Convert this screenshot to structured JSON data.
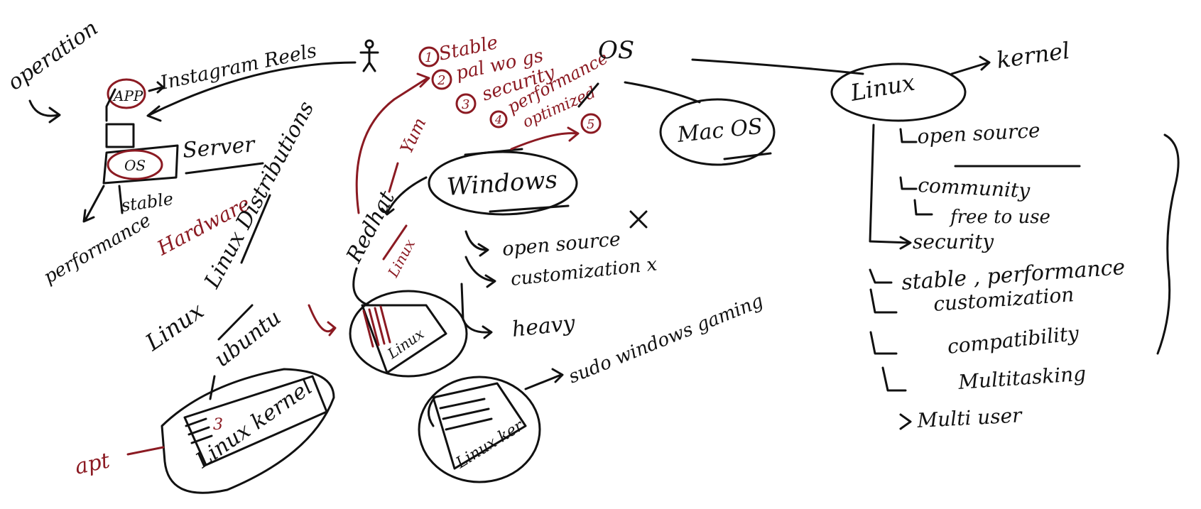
{
  "colors": {
    "ink": "#111111",
    "accent": "#8b1a22",
    "background": "#ffffff"
  },
  "notes": {
    "operation": "operation",
    "instagram_reels": "Instagram Reels",
    "app": "APP",
    "os_box": "OS",
    "server": "Server",
    "stable": "stable",
    "performance": "performance",
    "hardware": "Hardware",
    "os_main": "OS",
    "mac_os": "Mac OS",
    "linux_top": "Linux",
    "kernel": "kernel",
    "linux_distributions": "Linux Distributions",
    "ubuntu": "ubuntu",
    "apt": "apt",
    "linux_kernel": "Linux kernel",
    "redhat": "Redhat",
    "yum": "Yum",
    "linux_red": "Linux",
    "linux_small": "Linux",
    "linux_ker": "Linux ker",
    "windows": "Windows",
    "open_source_x": "open source",
    "customization_x": "customization x",
    "heavy": "heavy",
    "sudo": "sudo windows gaming",
    "num5": "5"
  },
  "os_props": [
    {
      "num": "1",
      "text": "Stable"
    },
    {
      "num": "2",
      "text": "pal wo gs"
    },
    {
      "num": "3",
      "text": "security"
    },
    {
      "num": "4",
      "text": "performance"
    },
    {
      "num": "",
      "text": "optimized"
    }
  ],
  "linux_features": [
    "open source",
    "community",
    "free to use",
    "security",
    "stable , performance",
    "customization",
    "compatibility",
    "Multitasking",
    "Multi user"
  ]
}
